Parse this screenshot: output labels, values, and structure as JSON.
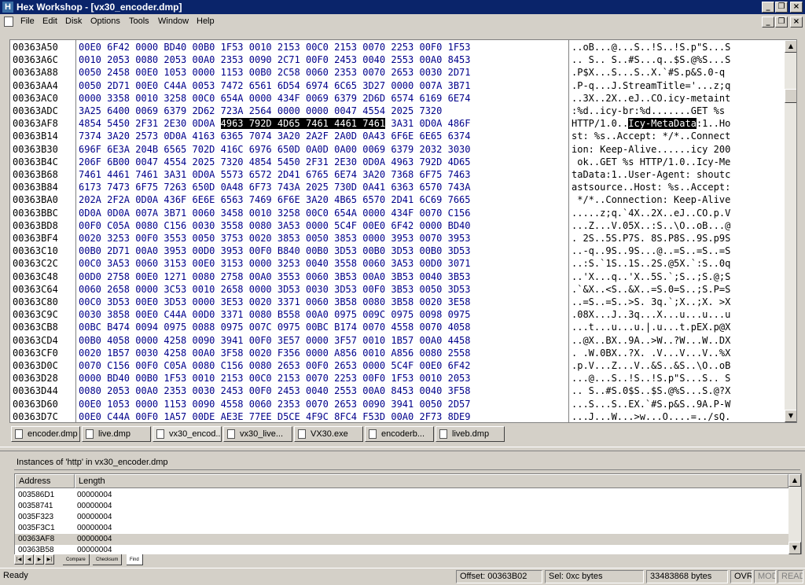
{
  "window": {
    "title": "Hex Workshop - [vx30_encoder.dmp]",
    "app_icon": "H",
    "controls": {
      "minimize": "_",
      "restore": "❐",
      "close": "×"
    }
  },
  "menubar": {
    "items": [
      "File",
      "Edit",
      "Disk",
      "Options",
      "Tools",
      "Window",
      "Help"
    ]
  },
  "hex_view": {
    "rows": [
      {
        "address": "00363A50",
        "bytes": "00E0 6F42 0000 BD40 00B0 1F53 0010 2153 00C0 2153 0070 2253 00F0 1F53",
        "ascii": "..oB...@...S..!S..!S.p\"S...S"
      },
      {
        "address": "00363A6C",
        "bytes": "0010 2053 0080 2053 00A0 2353 0090 2C71 00F0 2453 0040 2553 00A0 8453",
        "ascii": ".. S.. S..#S...q..$S.@%S...S"
      },
      {
        "address": "00363A88",
        "bytes": "0050 2458 00E0 1053 0000 1153 00B0 2C58 0060 2353 0070 2653 0030 2D71",
        "ascii": ".P$X...S...S..X.`#S.p&S.0-q"
      },
      {
        "address": "00363AA4",
        "bytes": "0050 2D71 00E0 C44A 0053 7472 6561 6D54 6974 6C65 3D27 0000 007A 3B71",
        "ascii": ".P-q...J.StreamTitle='...z;q"
      },
      {
        "address": "00363AC0",
        "bytes": "0000 3358 0010 3258 00C0 654A 0000 434F 0069 6379 2D6D 6574 6169 6E74",
        "ascii": "..3X..2X..eJ..CO.icy-metaint"
      },
      {
        "address": "00363ADC",
        "bytes": "3A25 6400 0069 6379 2D62 723A 2564 0000 0000 0047 4554 2025 7320",
        "ascii": ":%d..icy-br:%d.......GET %s "
      },
      {
        "address": "00363AF8",
        "bytes_pre": "4854 5450 2F31 2E30 0D0A ",
        "bytes_sel": "4963 792D 4D65 7461 4461 7461",
        "bytes_post": " 3A31 0D0A 486F",
        "ascii_pre": "HTTP/1.0..",
        "ascii_sel": "Icy-MetaData",
        "ascii_post": ":1..Ho"
      },
      {
        "address": "00363B14",
        "bytes": "7374 3A20 2573 0D0A 4163 6365 7074 3A20 2A2F 2A0D 0A43 6F6E 6E65 6374",
        "ascii": "st: %s..Accept: */*..Connect"
      },
      {
        "address": "00363B30",
        "bytes": "696F 6E3A 204B 6565 702D 416C 6976 650D 0A0D 0A00 0069 6379 2032 3030",
        "ascii": "ion: Keep-Alive......icy 200"
      },
      {
        "address": "00363B4C",
        "bytes": "206F 6B00 0047 4554 2025 7320 4854 5450 2F31 2E30 0D0A 4963 792D 4D65",
        "ascii": " ok..GET %s HTTP/1.0..Icy-Me"
      },
      {
        "address": "00363B68",
        "bytes": "7461 4461 7461 3A31 0D0A 5573 6572 2D41 6765 6E74 3A20 7368 6F75 7463",
        "ascii": "taData:1..User-Agent: shoutc"
      },
      {
        "address": "00363B84",
        "bytes": "6173 7473 6F75 7263 650D 0A48 6F73 743A 2025 730D 0A41 6363 6570 743A",
        "ascii": "astsource..Host: %s..Accept:"
      },
      {
        "address": "00363BA0",
        "bytes": "202A 2F2A 0D0A 436F 6E6E 6563 7469 6F6E 3A20 4B65 6570 2D41 6C69 7665",
        "ascii": " */*..Connection: Keep-Alive"
      },
      {
        "address": "00363BBC",
        "bytes": "0D0A 0D0A 007A 3B71 0060 3458 0010 3258 00C0 654A 0000 434F 0070 C156",
        "ascii": ".....z;q.`4X..2X..eJ..CO.p.V"
      },
      {
        "address": "00363BD8",
        "bytes": "00F0 C05A 0080 C156 0030 3558 0080 3A53 0000 5C4F 00E0 6F42 0000 BD40",
        "ascii": "...Z...V.05X..:S..\\O..oB...@"
      },
      {
        "address": "00363BF4",
        "bytes": "0020 3253 00F0 3553 0050 3753 0020 3853 0050 3853 0000 3953 0070 3953",
        "ascii": ". 2S..5S.P7S. 8S.P8S..9S.p9S"
      },
      {
        "address": "00363C10",
        "bytes": "00B0 2D71 00A0 3953 00D0 3953 00F0 B840 00B0 3D53 00B0 3D53 00B0 3D53",
        "ascii": "..-q..9S..9S...@..=S..=S..=S"
      },
      {
        "address": "00363C2C",
        "bytes": "00C0 3A53 0060 3153 00E0 3153 0000 3253 0040 3558 0060 3A53 00D0 3071",
        "ascii": "..:S.`1S..1S..2S.@5X.`:S..0q"
      },
      {
        "address": "00363C48",
        "bytes": "00D0 2758 00E0 1271 0080 2758 00A0 3553 0060 3B53 00A0 3B53 0040 3B53",
        "ascii": "..'X...q..'X..5S.`;S..;S.@;S"
      },
      {
        "address": "00363C64",
        "bytes": "0060 2658 0000 3C53 0010 2658 0000 3D53 0030 3D53 00F0 3B53 0050 3D53",
        "ascii": ".`&X..<S..&X..=S.0=S..;S.P=S"
      },
      {
        "address": "00363C80",
        "bytes": "00C0 3D53 00E0 3D53 0000 3E53 0020 3371 0060 3B58 0080 3B58 0020 3E58",
        "ascii": "..=S..=S..>S. 3q.`;X..;X. >X"
      },
      {
        "address": "00363C9C",
        "bytes": "0030 3858 00E0 C44A 00D0 3371 0080 B558 00A0 0975 009C 0975 0098 0975",
        "ascii": ".08X...J..3q...X...u...u...u"
      },
      {
        "address": "00363CB8",
        "bytes": "00BC B474 0094 0975 0088 0975 007C 0975 00BC B174 0070 4558 0070 4058",
        "ascii": "...t...u...u.|.u...t.pEX.p@X"
      },
      {
        "address": "00363CD4",
        "bytes": "00B0 4058 0000 4258 0090 3941 00F0 3E57 0000 3F57 0010 1B57 00A0 4458",
        "ascii": "..@X..BX..9A..>W..?W...W..DX"
      },
      {
        "address": "00363CF0",
        "bytes": "0020 1B57 0030 4258 00A0 3F58 0020 F356 0000 A856 0010 A856 0080 2558",
        "ascii": ". .W.0BX..?X. .V...V...V..%X"
      },
      {
        "address": "00363D0C",
        "bytes": "0070 C156 00F0 C05A 0080 C156 0080 2653 00F0 2653 0000 5C4F 00E0 6F42",
        "ascii": ".p.V...Z...V..&S..&S..\\O..oB"
      },
      {
        "address": "00363D28",
        "bytes": "0000 BD40 00B0 1F53 0010 2153 00C0 2153 0070 2253 00F0 1F53 0010 2053",
        "ascii": "...@...S..!S..!S.p\"S...S.. S"
      },
      {
        "address": "00363D44",
        "bytes": "0080 2053 00A0 2353 0030 2453 00F0 2453 0040 2553 00A0 8453 0040 3F58",
        "ascii": ".. S..#S.0$S..$S.@%S...S.@?X"
      },
      {
        "address": "00363D60",
        "bytes": "00E0 1053 0000 1153 0090 4558 0060 2353 0070 2653 0090 3941 0050 2D57",
        "ascii": "...S...S..EX.`#S.p&S..9A.P-W"
      },
      {
        "address": "00363D7C",
        "bytes": "00E0 C44A 00F0 1A57 00DE AE3E 77EE D5CE 4F9C 8FC4 F53D 00A0 2F73 8DE9",
        "ascii": "...J...W...>w...O....=../sQ."
      }
    ]
  },
  "doc_tabs": [
    "encoder.dmp",
    "live.dmp",
    "vx30_encod...",
    "vx30_live...",
    "VX30.exe",
    "encoderb...",
    "liveb.dmp"
  ],
  "find_panel": {
    "title": "Instances of 'http' in vx30_encoder.dmp",
    "columns": [
      "Address",
      "Length"
    ],
    "rows": [
      {
        "address": "003586D1",
        "length": "00000004"
      },
      {
        "address": "00358741",
        "length": "00000004"
      },
      {
        "address": "0035F323",
        "length": "00000004"
      },
      {
        "address": "0035F3C1",
        "length": "00000004"
      },
      {
        "address": "00363AF8",
        "length": "00000004"
      },
      {
        "address": "00363B58",
        "length": "00000004"
      }
    ]
  },
  "bottom_tabs": [
    "Compare",
    "Checksum",
    "Find"
  ],
  "statusbar": {
    "ready": "Ready",
    "offset": "Offset: 00363B02",
    "selection": "Sel: 0xc bytes",
    "size": "33483868 bytes",
    "ovr": "OVR",
    "mod": "MOD",
    "read": "READ"
  },
  "colors": {
    "titlebar": "#0a246a",
    "hex_bytes": "#00008b",
    "selection": "#000000",
    "face": "#d4d0c8"
  }
}
